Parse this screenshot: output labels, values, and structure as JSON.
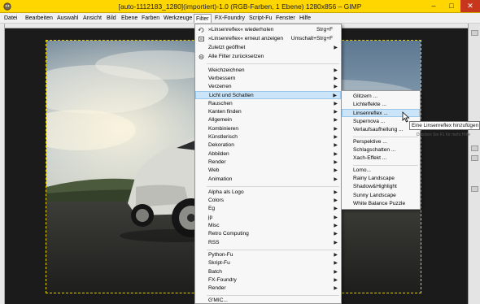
{
  "window": {
    "title": "[auto-1112183_1280](importiert)-1.0 (RGB-Farben, 1 Ebene) 1280x856 – GIMP",
    "min_label": "–",
    "max_label": "□",
    "close_label": "✕"
  },
  "menubar": {
    "items": [
      "Datei",
      "Bearbeiten",
      "Auswahl",
      "Ansicht",
      "Bild",
      "Ebene",
      "Farben",
      "Werkzeuge",
      "Filter",
      "FX-Foundry",
      "Script-Fu",
      "Fenster",
      "Hilfe"
    ],
    "active_index": 8
  },
  "filter_menu": {
    "items": [
      {
        "label": "»Linsenreflex« wiederholen",
        "accel": "Strg+F",
        "icon": "repeat-icon"
      },
      {
        "label": "»Linsenreflex« erneut anzeigen",
        "accel": "Umschalt+Strg+F",
        "icon": "reshow-icon"
      },
      {
        "label": "Zuletzt geöffnet",
        "submenu": true
      },
      {
        "label": "Alle Filter zurücksetzen",
        "icon": "reset-icon"
      },
      {
        "label": "Weichzeichnen",
        "submenu": true
      },
      {
        "label": "Verbessern",
        "submenu": true
      },
      {
        "label": "Verzerren",
        "submenu": true
      },
      {
        "label": "Licht und Schatten",
        "submenu": true,
        "highlighted": true
      },
      {
        "label": "Rauschen",
        "submenu": true
      },
      {
        "label": "Kanten finden",
        "submenu": true
      },
      {
        "label": "Allgemein",
        "submenu": true
      },
      {
        "label": "Kombinieren",
        "submenu": true
      },
      {
        "label": "Künstlerisch",
        "submenu": true
      },
      {
        "label": "Dekoration",
        "submenu": true
      },
      {
        "label": "Abbilden",
        "submenu": true
      },
      {
        "label": "Render",
        "submenu": true
      },
      {
        "label": "Web",
        "submenu": true
      },
      {
        "label": "Animation",
        "submenu": true
      },
      {
        "label": "Alpha als Logo",
        "submenu": true
      },
      {
        "label": "Colors",
        "submenu": true
      },
      {
        "label": "Eg",
        "submenu": true
      },
      {
        "label": "jp",
        "submenu": true
      },
      {
        "label": "Misc",
        "submenu": true
      },
      {
        "label": "Retro Computing",
        "submenu": true
      },
      {
        "label": "RSS",
        "submenu": true
      },
      {
        "label": "Python-Fu",
        "submenu": true
      },
      {
        "label": "Skript-Fu",
        "submenu": true
      },
      {
        "label": "Batch",
        "submenu": true
      },
      {
        "label": "FX-Foundry",
        "submenu": true
      },
      {
        "label": "Render",
        "submenu": true
      },
      {
        "label": "G'MIC..."
      }
    ]
  },
  "light_shadow_menu": {
    "items": [
      {
        "label": "Glitzern ..."
      },
      {
        "label": "Lichteffekte ..."
      },
      {
        "label": "Linsenreflex ...",
        "highlighted": true
      },
      {
        "label": "Supernova ..."
      },
      {
        "label": "Verlaufsaufhellung ..."
      },
      {
        "label": "Perspektive ..."
      },
      {
        "label": "Schlagschatten ..."
      },
      {
        "label": "Xach-Effekt ..."
      },
      {
        "label": "Lomo..."
      },
      {
        "label": "Rainy Landscape"
      },
      {
        "label": "Shadow&Highlight"
      },
      {
        "label": "Sunny Landscape"
      },
      {
        "label": "White Balance Puzzle"
      }
    ]
  },
  "tooltip": {
    "text": "Eine Linsenreflex hinzufügen",
    "hint": "Drücken Sie F1 für mehr Hilfe"
  },
  "colors": {
    "titlebar": "#ffd600",
    "highlight": "#cce4f7",
    "close": "#c7371d"
  }
}
